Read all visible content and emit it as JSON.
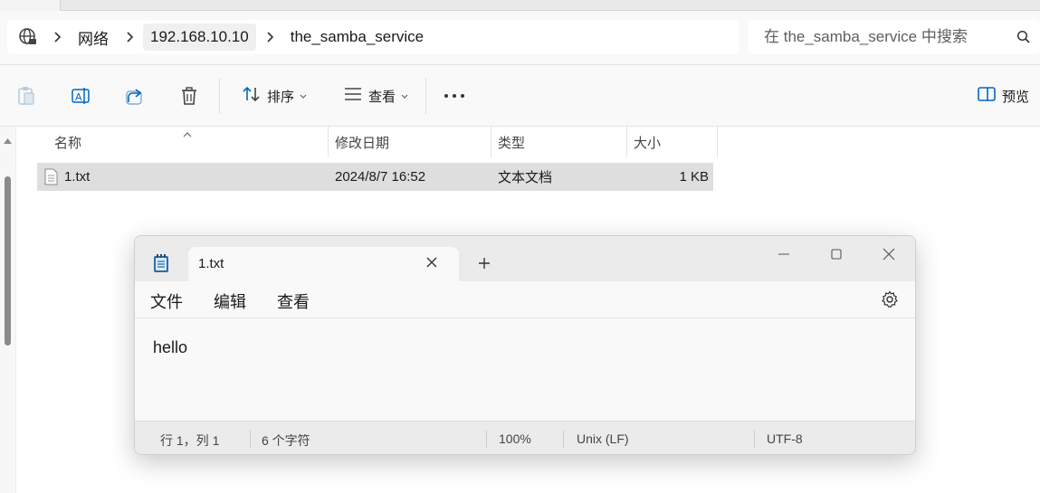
{
  "explorer": {
    "breadcrumb": [
      "网络",
      "192.168.10.10",
      "the_samba_service"
    ],
    "search_placeholder": "在 the_samba_service 中搜索",
    "toolbar": {
      "sort_label": "排序",
      "view_label": "查看",
      "preview_label": "预览"
    },
    "columns": {
      "name": "名称",
      "modified": "修改日期",
      "type": "类型",
      "size": "大小"
    },
    "files": [
      {
        "name": "1.txt",
        "modified": "2024/8/7 16:52",
        "type": "文本文档",
        "size": "1 KB"
      }
    ]
  },
  "notepad": {
    "tab_title": "1.txt",
    "menu": [
      "文件",
      "编辑",
      "查看"
    ],
    "content": "hello",
    "status": {
      "position": "行 1，列 1",
      "chars": "6 个字符",
      "zoom": "100%",
      "line_ending": "Unix (LF)",
      "encoding": "UTF-8"
    }
  },
  "colors": {
    "chrome": "#f9f9f9",
    "selected_row": "#dedede",
    "accent_blue": "#0067c0",
    "notepad_icon": "#1e4f7a"
  }
}
